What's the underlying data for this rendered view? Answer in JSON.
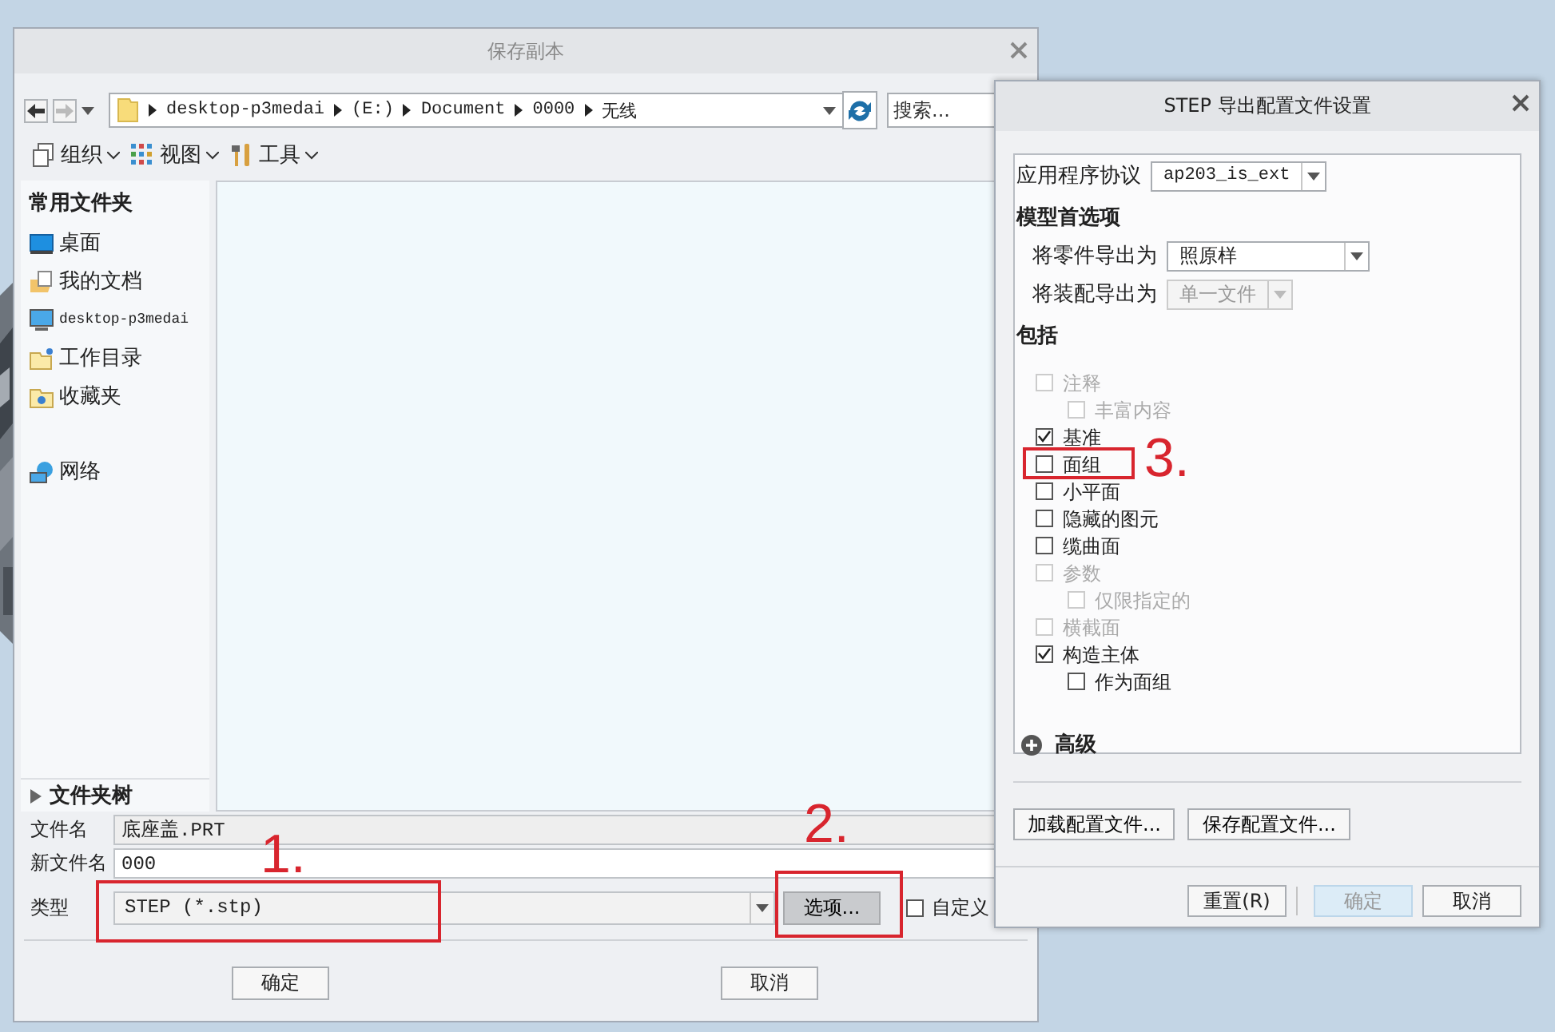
{
  "save_dialog": {
    "title": "保存副本",
    "nav": {
      "path": [
        "desktop-p3medai",
        "(E:)",
        "Document",
        "0000",
        "无线"
      ],
      "search_placeholder": "搜索..."
    },
    "toolbar": [
      {
        "label": "组织"
      },
      {
        "label": "视图"
      },
      {
        "label": "工具"
      }
    ],
    "sidebar": {
      "heading": "常用文件夹",
      "items": [
        {
          "label": "桌面"
        },
        {
          "label": "我的文档"
        },
        {
          "label": "desktop-p3medai"
        },
        {
          "label": "工作目录"
        },
        {
          "label": "收藏夹"
        },
        {
          "label": "网络"
        }
      ]
    },
    "folder_tree": {
      "label": "文件夹树",
      "expanded": false
    },
    "fields": [
      {
        "label": "文件名",
        "value": "底座盖.PRT",
        "disabled": true
      },
      {
        "label": "新文件名",
        "value": "000",
        "disabled": false
      }
    ],
    "type": {
      "label": "类型",
      "value": "STEP (*.stp)"
    },
    "options_button": "选项...",
    "custom_checkbox": {
      "label": "自定义",
      "checked": false
    },
    "buttons": [
      "确定",
      "取消"
    ]
  },
  "export_dialog": {
    "title": "STEP 导出配置文件设置",
    "protocol": {
      "label": "应用程序协议",
      "value": "ap203_is_ext"
    },
    "model_prefs": {
      "heading": "模型首选项",
      "rows": [
        {
          "label": "将零件导出为",
          "value": "照原样",
          "disabled": false
        },
        {
          "label": "将装配导出为",
          "value": "单一文件",
          "disabled": true
        }
      ]
    },
    "include": {
      "heading": "包括",
      "items": [
        {
          "label": "注释",
          "checked": false,
          "disabled": true,
          "children": [
            {
              "label": "丰富内容",
              "checked": false,
              "disabled": true
            }
          ]
        },
        {
          "label": "基准",
          "checked": true,
          "disabled": false
        },
        {
          "label": "面组",
          "checked": false,
          "disabled": false
        },
        {
          "label": "小平面",
          "checked": false,
          "disabled": false
        },
        {
          "label": "隐藏的图元",
          "checked": false,
          "disabled": false
        },
        {
          "label": "缆曲面",
          "checked": false,
          "disabled": false
        },
        {
          "label": "参数",
          "checked": false,
          "disabled": true,
          "children": [
            {
              "label": "仅限指定的",
              "checked": false,
              "disabled": true
            }
          ]
        },
        {
          "label": "横截面",
          "checked": false,
          "disabled": true
        },
        {
          "label": "构造主体",
          "checked": true,
          "disabled": false,
          "children": [
            {
              "label": "作为面组",
              "checked": false,
              "disabled": false
            }
          ]
        }
      ]
    },
    "advanced": {
      "label": "高级",
      "expanded": false
    },
    "config_buttons": [
      "加载配置文件...",
      "保存配置文件..."
    ],
    "buttons": [
      {
        "label": "重置(R)",
        "disabled": false
      },
      {
        "label": "确定",
        "disabled": true
      },
      {
        "label": "取消",
        "disabled": false
      }
    ]
  },
  "annotations": [
    {
      "label": "1."
    },
    {
      "label": "2."
    },
    {
      "label": "3."
    }
  ]
}
